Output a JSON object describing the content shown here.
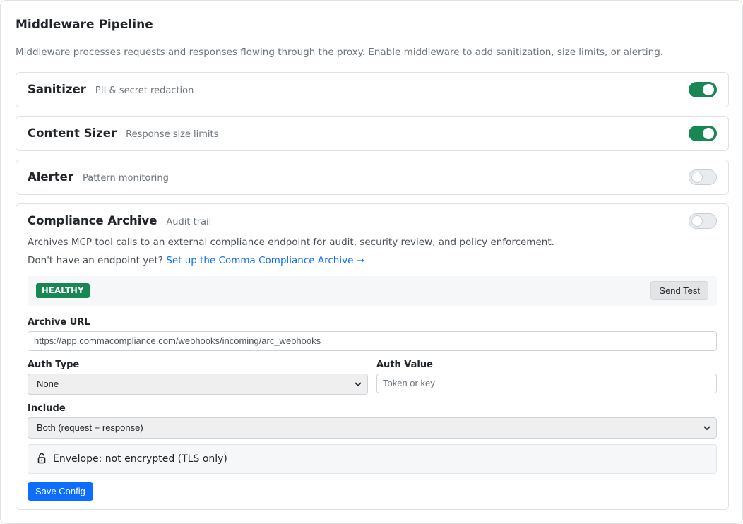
{
  "title": "Middleware Pipeline",
  "description": "Middleware processes requests and responses flowing through the proxy. Enable middleware to add sanitization, size limits, or alerting.",
  "middleware": [
    {
      "name": "Sanitizer",
      "subtitle": "PII & secret redaction",
      "enabled": true
    },
    {
      "name": "Content Sizer",
      "subtitle": "Response size limits",
      "enabled": true
    },
    {
      "name": "Alerter",
      "subtitle": "Pattern monitoring",
      "enabled": false
    }
  ],
  "compliance": {
    "name": "Compliance Archive",
    "subtitle": "Audit trail",
    "enabled": false,
    "description": "Archives MCP tool calls to an external compliance endpoint for audit, security review, and policy enforcement.",
    "cta_prefix": "Don't have an endpoint yet?",
    "cta_link": "Set up the Comma Compliance Archive →",
    "status_badge": "HEALTHY",
    "send_test_label": "Send Test",
    "archive_url_label": "Archive URL",
    "archive_url_value": "https://app.commacompliance.com/webhooks/incoming/arc_webhooks",
    "auth_type_label": "Auth Type",
    "auth_type_value": "None",
    "auth_value_label": "Auth Value",
    "auth_value_placeholder": "Token or key",
    "include_label": "Include",
    "include_value": "Both (request + response)",
    "envelope_text": "Envelope: not encrypted (TLS only)",
    "save_label": "Save Config"
  },
  "colors": {
    "toggle_on": "#198754",
    "badge_healthy": "#198754",
    "primary": "#0d6efd"
  }
}
